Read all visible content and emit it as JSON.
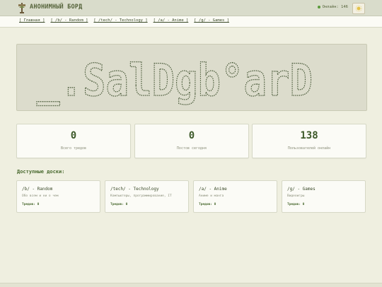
{
  "header": {
    "title": "АНОНИМНЫЙ БОРД",
    "online_label": "Онлайн: 146",
    "logo_icon": "tree-sign-icon",
    "theme_icon": "sun-icon"
  },
  "nav": {
    "links": [
      "[ Главная ]",
      "[ /b/ - Random ]",
      "[ /tech/ - Technology ]",
      "[ /a/ - Anime ]",
      "[ /g/ - Games ]"
    ]
  },
  "banner": {
    "ascii_text": "_.SalDgb°arD"
  },
  "stats": [
    {
      "value": "0",
      "label": "Всего тредов"
    },
    {
      "value": "0",
      "label": "Постов сегодня"
    },
    {
      "value": "138",
      "label": "Пользователей онлайн"
    }
  ],
  "boards_section": {
    "heading": "Доступные доски:",
    "boards": [
      {
        "name": "/b/ - Random",
        "desc": "Обо всем и ни о чем",
        "threads": "Тредов: 0"
      },
      {
        "name": "/tech/ - Technology",
        "desc": "Компьютеры, программирование, IT",
        "threads": "Тредов: 0"
      },
      {
        "name": "/a/ - Anime",
        "desc": "Аниме и манга",
        "threads": "Тредов: 0"
      },
      {
        "name": "/g/ - Games",
        "desc": "Видеоигры",
        "threads": "Тредов: 0"
      }
    ]
  },
  "colors": {
    "accent": "#4a6a30",
    "background": "#efefe0",
    "online_dot": "#5a9a3a"
  }
}
